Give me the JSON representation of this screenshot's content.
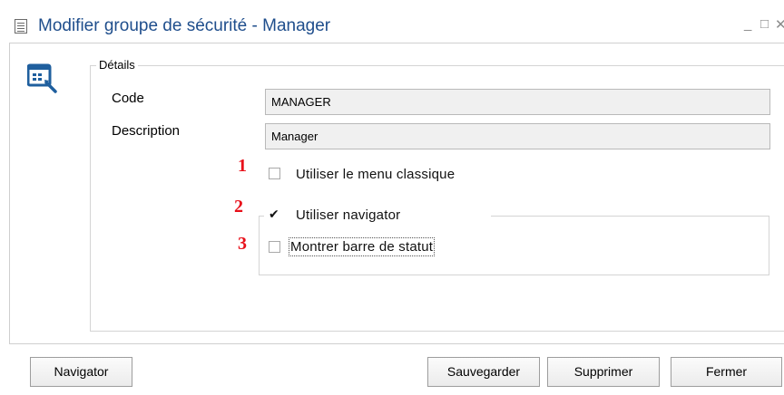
{
  "window": {
    "title": "Modifier groupe de sécurité - Manager",
    "controls": {
      "minimize": "_",
      "maximize": "□",
      "close": "✕"
    }
  },
  "form_icon": "security-form-icon",
  "details": {
    "legend": "Détails",
    "code_label": "Code",
    "code_value": "MANAGER",
    "description_label": "Description",
    "description_value": "Manager"
  },
  "options": [
    {
      "marker": "1",
      "label": "Utiliser le menu classique",
      "checked": false
    },
    {
      "marker": "2",
      "label": "Utiliser navigator",
      "checked": true
    },
    {
      "marker": "3",
      "label": "Montrer barre de statut",
      "checked": false
    }
  ],
  "buttons": {
    "navigator": "Navigator",
    "save": "Sauvegarder",
    "delete": "Supprimer",
    "close": "Fermer"
  },
  "colors": {
    "title": "#1f4e8c",
    "icon": "#1f5f9e",
    "marker": "#e8101a"
  }
}
